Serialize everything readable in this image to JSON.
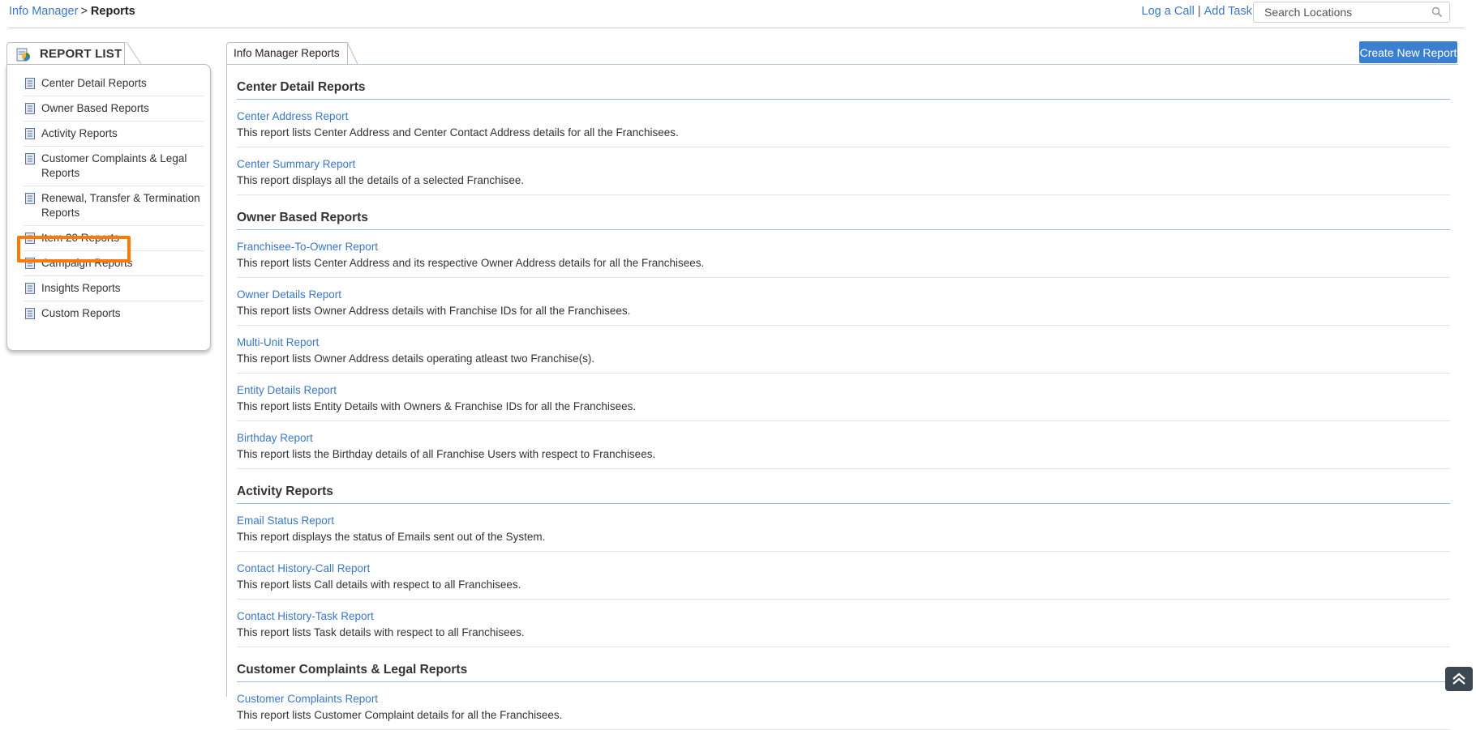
{
  "breadcrumb": {
    "parent": "Info Manager",
    "separator": ">",
    "current": "Reports"
  },
  "top_actions": {
    "log_call": "Log a Call",
    "divider": "|",
    "add_task": "Add Task",
    "search_placeholder": "Search Locations"
  },
  "sidebar": {
    "title": "REPORT LIST",
    "items": [
      {
        "label": "Center Detail Reports"
      },
      {
        "label": "Owner Based Reports"
      },
      {
        "label": "Activity Reports"
      },
      {
        "label": "Customer Complaints & Legal Reports"
      },
      {
        "label": "Renewal, Transfer & Termination Reports"
      },
      {
        "label": "Item 20 Reports"
      },
      {
        "label": "Campaign Reports"
      },
      {
        "label": "Insights Reports"
      },
      {
        "label": "Custom Reports"
      }
    ],
    "highlighted_item": "Item 20 Reports",
    "highlight_color": "#ff7a00"
  },
  "main": {
    "tab_label": "Info Manager Reports",
    "create_button": "Create New Report",
    "accent_color": "#3b7fd0",
    "sections": [
      {
        "title": "Center Detail Reports",
        "reports": [
          {
            "name": "Center Address Report",
            "desc": "This report lists Center Address and Center Contact Address details for all the Franchisees."
          },
          {
            "name": "Center Summary Report",
            "desc": "This report displays all the details of a selected Franchisee."
          }
        ]
      },
      {
        "title": "Owner Based Reports",
        "reports": [
          {
            "name": "Franchisee-To-Owner Report",
            "desc": "This report lists Center Address and its respective Owner Address details for all the Franchisees."
          },
          {
            "name": "Owner Details Report",
            "desc": "This report lists Owner Address details with Franchise IDs for all the Franchisees."
          },
          {
            "name": "Multi-Unit Report",
            "desc": "This report lists Owner Address details operating atleast two Franchise(s)."
          },
          {
            "name": "Entity Details Report",
            "desc": "This report lists Entity Details with Owners & Franchise IDs for all the Franchisees."
          },
          {
            "name": "Birthday Report",
            "desc": "This report lists the Birthday details of all Franchise Users with respect to Franchisees."
          }
        ]
      },
      {
        "title": "Activity Reports",
        "reports": [
          {
            "name": "Email Status Report",
            "desc": "This report displays the status of Emails sent out of the System."
          },
          {
            "name": "Contact History-Call Report",
            "desc": "This report lists Call details with respect to all Franchisees."
          },
          {
            "name": "Contact History-Task Report",
            "desc": "This report lists Task details with respect to all Franchisees."
          }
        ]
      },
      {
        "title": "Customer Complaints & Legal Reports",
        "reports": [
          {
            "name": "Customer Complaints Report",
            "desc": "This report lists Customer Complaint details for all the Franchisees."
          }
        ]
      }
    ]
  },
  "icons": {
    "search": "search-icon",
    "report_list": "report-list-icon",
    "document": "document-icon",
    "scroll_top": "double-chevron-up-icon"
  }
}
